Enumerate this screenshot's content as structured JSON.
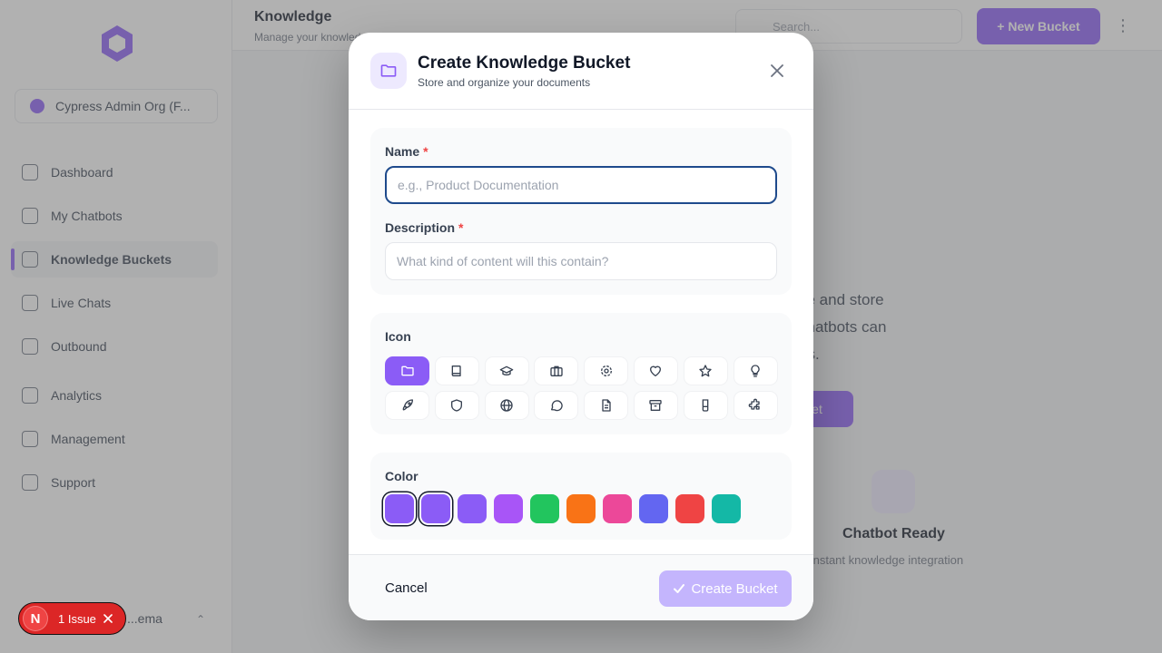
{
  "app": {
    "org_name": "Cypress Admin Org (F...",
    "nav": [
      {
        "label": "Dashboard"
      },
      {
        "label": "My Chatbots"
      },
      {
        "label": "Knowledge Buckets",
        "active": true
      },
      {
        "label": "Live Chats"
      },
      {
        "label": "Outbound"
      },
      {
        "label": "Analytics"
      },
      {
        "label": "Management"
      },
      {
        "label": "Support"
      }
    ],
    "bottom_user": "...ema"
  },
  "header": {
    "title": "Knowledge",
    "subtitle": "Manage your knowled...",
    "search_placeholder": "Search...",
    "new_bucket": "+ New Bucket"
  },
  "background": {
    "empty_title": "et",
    "empty_text": "ze and store\n chatbots can\nes.",
    "empty_btn": "et",
    "ready_title": "Chatbot Ready",
    "ready_sub": "Instant knowledge integration"
  },
  "modal": {
    "title": "Create Knowledge Bucket",
    "subtitle": "Store and organize your documents",
    "name_label": "Name",
    "name_placeholder": "e.g., Product Documentation",
    "name_value": "",
    "description_label": "Description",
    "description_placeholder": "What kind of content will this contain?",
    "description_value": "",
    "required_mark": "*",
    "icon_label": "Icon",
    "icons": [
      "folder-icon",
      "book-icon",
      "graduation-cap-icon",
      "briefcase-icon",
      "gear-icon",
      "heart-icon",
      "star-icon",
      "lightbulb-icon",
      "rocket-icon",
      "shield-icon",
      "globe-icon",
      "chat-bubble-icon",
      "document-icon",
      "archive-icon",
      "flask-icon",
      "puzzle-icon"
    ],
    "selected_icon": "folder-icon",
    "color_label": "Color",
    "colors": [
      "#8b5cf6",
      "#8b5cf6",
      "#8b5cf6",
      "#a855f7",
      "#22c55e",
      "#f97316",
      "#ec4899",
      "#6366f1",
      "#ef4444",
      "#14b8a6"
    ],
    "selected_colors": [
      0,
      1
    ],
    "cancel_label": "Cancel",
    "create_label": "Create Bucket"
  },
  "issue_badge": {
    "initial": "N",
    "text": "1 Issue"
  },
  "colors": {
    "accent": "#8b5cf6",
    "accent_light": "#ede9fe",
    "disabled_button": "#c4b5fd",
    "issue_red": "#dc2626",
    "focus_border": "#1e4a8c"
  }
}
